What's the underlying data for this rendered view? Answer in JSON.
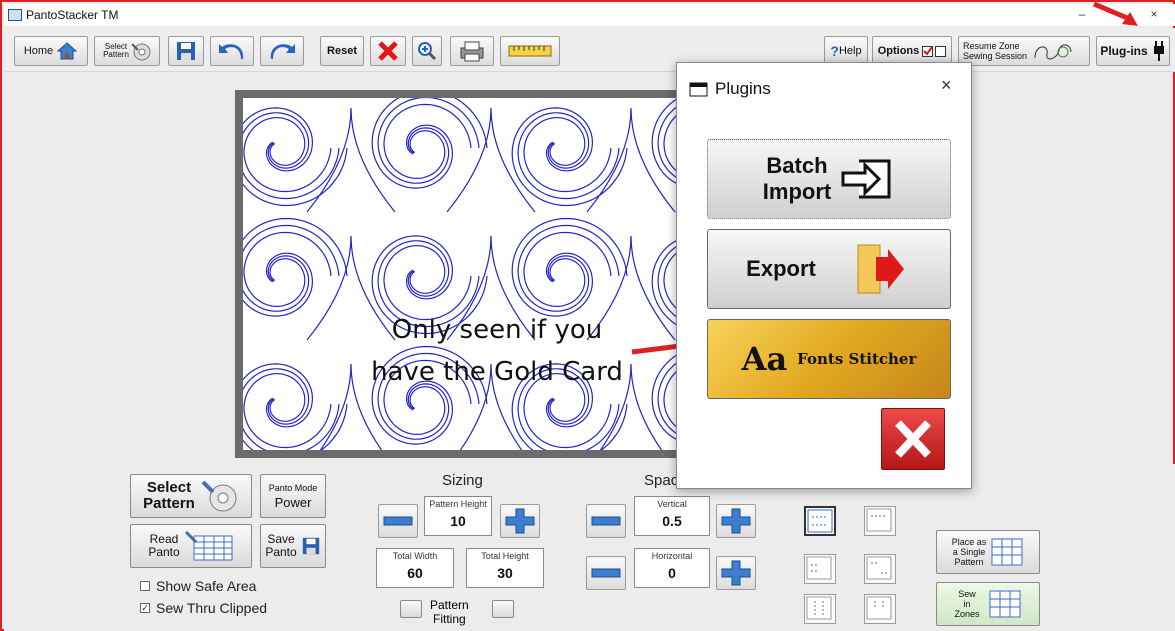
{
  "window": {
    "title": "PantoStacker TM",
    "min": "–",
    "max": "▫",
    "close": "×"
  },
  "toolbar": {
    "home": "Home",
    "select_pattern": [
      "Select",
      "Pattern"
    ],
    "reset": "Reset",
    "help": "Help",
    "help_q": "?",
    "options": "Options",
    "resume": [
      "Resume Zone",
      "Sewing Session"
    ],
    "plugins": "Plug-ins"
  },
  "annotation": {
    "line1": "Only seen if you",
    "line2": "have the Gold Card"
  },
  "bottom": {
    "select_pattern": [
      "Select",
      "Pattern"
    ],
    "panto_mode_label": "Panto Mode",
    "panto_mode_value": "Power",
    "read_panto": [
      "Read",
      "Panto"
    ],
    "save_panto": [
      "Save",
      "Panto"
    ],
    "show_safe_area": "Show Safe Area",
    "sew_thru_clipped": "Sew Thru Clipped",
    "sizing_title": "Sizing",
    "pattern_height_label": "Pattern Height",
    "pattern_height_value": "10",
    "total_width_label": "Total Width",
    "total_width_value": "60",
    "total_height_label": "Total Height",
    "total_height_value": "30",
    "pattern_fitting": [
      "Pattern",
      "Fitting"
    ],
    "spacing_title": "Spac",
    "vertical_label": "Vertical",
    "vertical_value": "0.5",
    "horizontal_label": "Horizontal",
    "horizontal_value": "0",
    "place_single": [
      "Place as",
      "a Single",
      "Pattern"
    ],
    "sew_zones": [
      "Sew",
      "in",
      "Zones"
    ]
  },
  "dialog": {
    "title": "Plugins",
    "close": "×",
    "batch_import": [
      "Batch",
      "Import"
    ],
    "export": "Export",
    "fonts_aa": "Aa",
    "fonts_stitcher": "Fonts Stitcher"
  },
  "colors": {
    "accent_red": "#e02020",
    "stitch_blue": "#2323c8",
    "gold": "#e2a820"
  }
}
